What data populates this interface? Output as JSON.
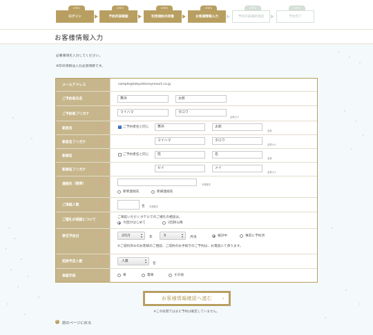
{
  "steps": [
    {
      "num": "STEP1",
      "label": "ログイン",
      "state": "done"
    },
    {
      "num": "STEP2",
      "label": "予約内容確認",
      "state": "done"
    },
    {
      "num": "STEP3",
      "label": "利用規約の同意",
      "state": "done"
    },
    {
      "num": "STEP4",
      "label": "お客様情報入力",
      "state": "done"
    },
    {
      "num": "STEP5",
      "label": "予約内容最終確認",
      "state": "todo"
    },
    {
      "num": "STEP6",
      "label": "予約完了",
      "state": "todo"
    }
  ],
  "page_title": "お客様情報入力",
  "notes": [
    "必要事項を入力してください。",
    "※印の項目は入力必須項目です。"
  ],
  "required_mark": "※",
  "form": {
    "email": {
      "label": "メールアドレス",
      "value": "sample@tokyodisneyresort.co.jp"
    },
    "booker_name": {
      "label": "ご予約者氏名",
      "last": "舞浜",
      "first": "太郎"
    },
    "booker_kana": {
      "label": "ご予約者フリガナ",
      "last": "マイハマ",
      "first": "タロウ",
      "hint": "全角カナ"
    },
    "groom_name": {
      "label": "新郎名",
      "same_label": "ご予約者名と同じ",
      "same_checked": true,
      "last": "舞浜",
      "first": "太郎",
      "hint": "全角"
    },
    "groom_kana": {
      "label": "新郎名フリガナ",
      "last": "マイハマ",
      "first": "タロウ",
      "hint": "全角カナ"
    },
    "bride_name": {
      "label": "新婦名",
      "same_label": "ご予約者名と同じ",
      "same_checked": false,
      "last": "姓",
      "first": "名",
      "hint": "全角"
    },
    "bride_kana": {
      "label": "新婦名フリガナ",
      "last": "セイ",
      "first": "メイ",
      "hint": "全角カナ"
    },
    "phone": {
      "label": "連絡先（携帯）",
      "value": "",
      "hint": "半角数字",
      "options": [
        "新郎連絡先",
        "新婦連絡先"
      ]
    },
    "guests": {
      "label": "ご来館人数",
      "value": "",
      "unit": "名",
      "hint": "半角数字"
    },
    "consult": {
      "label": "ご婚礼の相談について",
      "question": "ご来館いただくホテルでのご婚礼の相談は、",
      "options": [
        "今回がはじめて",
        "2回目以降"
      ],
      "selected": 0
    },
    "wedding_date": {
      "label": "挙式予定日",
      "year": "2015",
      "year_unit": "年",
      "month": "9",
      "month_unit": "月頃",
      "options": [
        "検討中",
        "事前に予約済"
      ],
      "selected": 0,
      "note": "※ご成約済みのお客様のご相談、ご成約のお手続きのご予約は、お電話にて承ります。"
    },
    "guest_count": {
      "label": "招待予定人数",
      "value": "人数",
      "unit": "名"
    },
    "transport": {
      "label": "来館手段",
      "options": [
        "車",
        "電車",
        "その他"
      ]
    }
  },
  "submit": {
    "label": "お客様情報確認へ進む",
    "arrow": "›",
    "note": "※この段階ではまだ予約は確定していません。"
  },
  "back_link": "前のページに戻る",
  "colors": {
    "gold": "#b89f61",
    "label_bg": "#c7b68b",
    "required": "#e79a9a",
    "background": "#f4f9fc"
  }
}
